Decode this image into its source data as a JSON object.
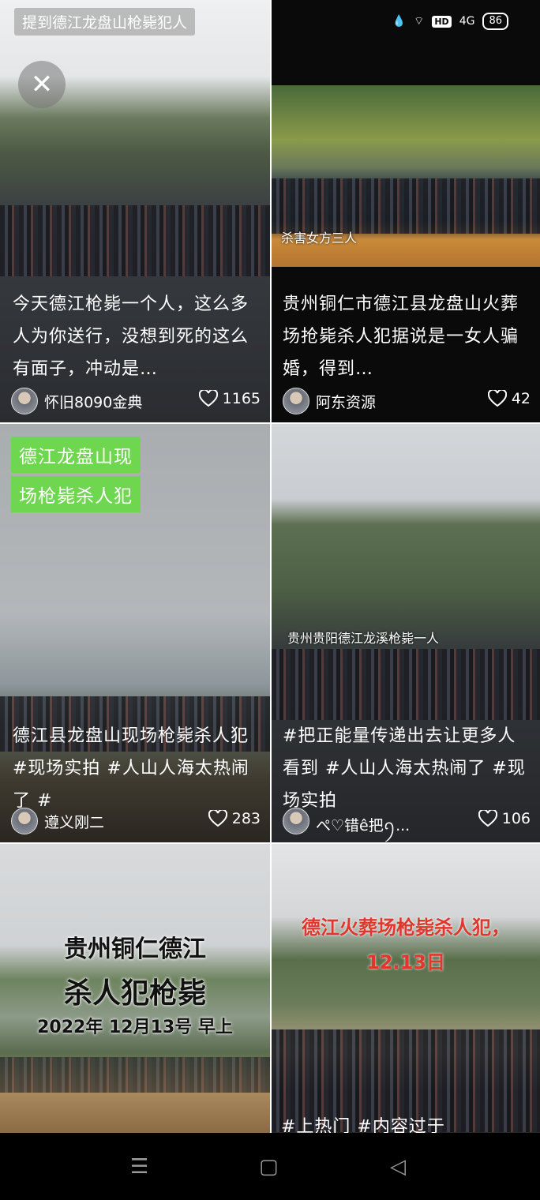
{
  "status_bar": {
    "battery": "86",
    "network": "4G",
    "hd": "HD"
  },
  "cards": [
    {
      "banner": "提到德江龙盘山枪毙犯人",
      "text": "今天德江枪毙一个人，这么多人为你送行，没想到死的这么有面子，冲动是…",
      "author": "怀旧8090金典",
      "likes": "1165"
    },
    {
      "photo_caption": "杀害女方三人",
      "text": "贵州铜仁市德江县龙盘山火葬场抢毙杀人犯据说是一女人骗婚，得到…",
      "author": "阿东资源",
      "likes": "42"
    },
    {
      "tag_line1": "德江龙盘山现",
      "tag_line2": "场枪毙杀人犯",
      "text": "德江县龙盘山现场枪毙杀人犯#现场实拍 #人山人海太热闹了 #",
      "author": "遵义刚二",
      "likes": "283"
    },
    {
      "photo_caption": "贵州贵阳德江龙溪枪毙一人",
      "text": "#把正能量传递出去让更多人看到 #人山人海太热闹了 #现场实拍",
      "author": "ぺ♡错ê把ꪆ...",
      "likes": "106"
    },
    {
      "title_line1": "贵州铜仁德江",
      "title_line2": "杀人犯枪毙",
      "title_line3": "2022年 12月13号 早上"
    },
    {
      "red_line1": "德江火葬场枪毙杀人犯，",
      "red_line2": "12.13日",
      "bottom_text": "#上热门 #内容过于"
    }
  ],
  "colors": {
    "tag_green": "#6fd64f",
    "red_title": "#e0362b"
  },
  "icons": {
    "close": "close-icon",
    "heart": "heart-icon",
    "nav_menu": "menu-icon",
    "nav_home": "home-icon",
    "nav_back": "back-icon"
  }
}
